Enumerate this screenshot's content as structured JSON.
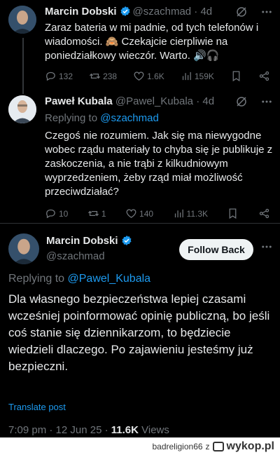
{
  "tweets": [
    {
      "name": "Marcin Dobski",
      "handle": "@szachmad",
      "time": "· 4d",
      "text": "Zaraz bateria w mi padnie, od tych telefonów i wiadomości. 🙈 Czekajcie cierpliwie na poniedziałkowy wieczór. Warto. 🔊🎧",
      "replies": "132",
      "reposts": "238",
      "likes": "1.6K",
      "views": "159K"
    },
    {
      "name": "Paweł Kubala",
      "handle": "@Pawel_Kubala",
      "time": "· 4d",
      "replying_prefix": "Replying to",
      "replying_to": "@szachmad",
      "text": "Czegoś nie rozumiem. Jak się ma niewygodne wobec rządu materiały to chyba się je publikuje z zaskoczenia, a nie trąbi z kilkudniowym wyprzedzeniem, żeby rząd miał możliwość przeciwdziałać?",
      "replies": "10",
      "reposts": "1",
      "likes": "140",
      "views": "11.3K"
    }
  ],
  "main_tweet": {
    "name": "Marcin Dobski",
    "handle": "@szachmad",
    "follow_label": "Follow Back",
    "replying_prefix": "Replying to",
    "replying_to": "@Pawel_Kubala",
    "text": "Dla własnego bezpieczeństwa lepiej czasami wcześniej poinformować opinię publiczną, bo jeśli coś stanie się dziennikarzom, to będziecie wiedzieli dlaczego. Po zajawieniu jesteśmy już bezpieczni.",
    "translate": "Translate post",
    "time": "7:09 pm · 12 Jun 25 ·",
    "views_count": "11.6K",
    "views_label": "Views"
  },
  "footer": {
    "user": "badreligion66",
    "sep": "z",
    "site": "wykop.pl"
  },
  "colors": {
    "background": "#000000",
    "text": "#e7e9ea",
    "muted": "#71767b",
    "link": "#1d9bf0",
    "verified": "#1d9bf0"
  }
}
